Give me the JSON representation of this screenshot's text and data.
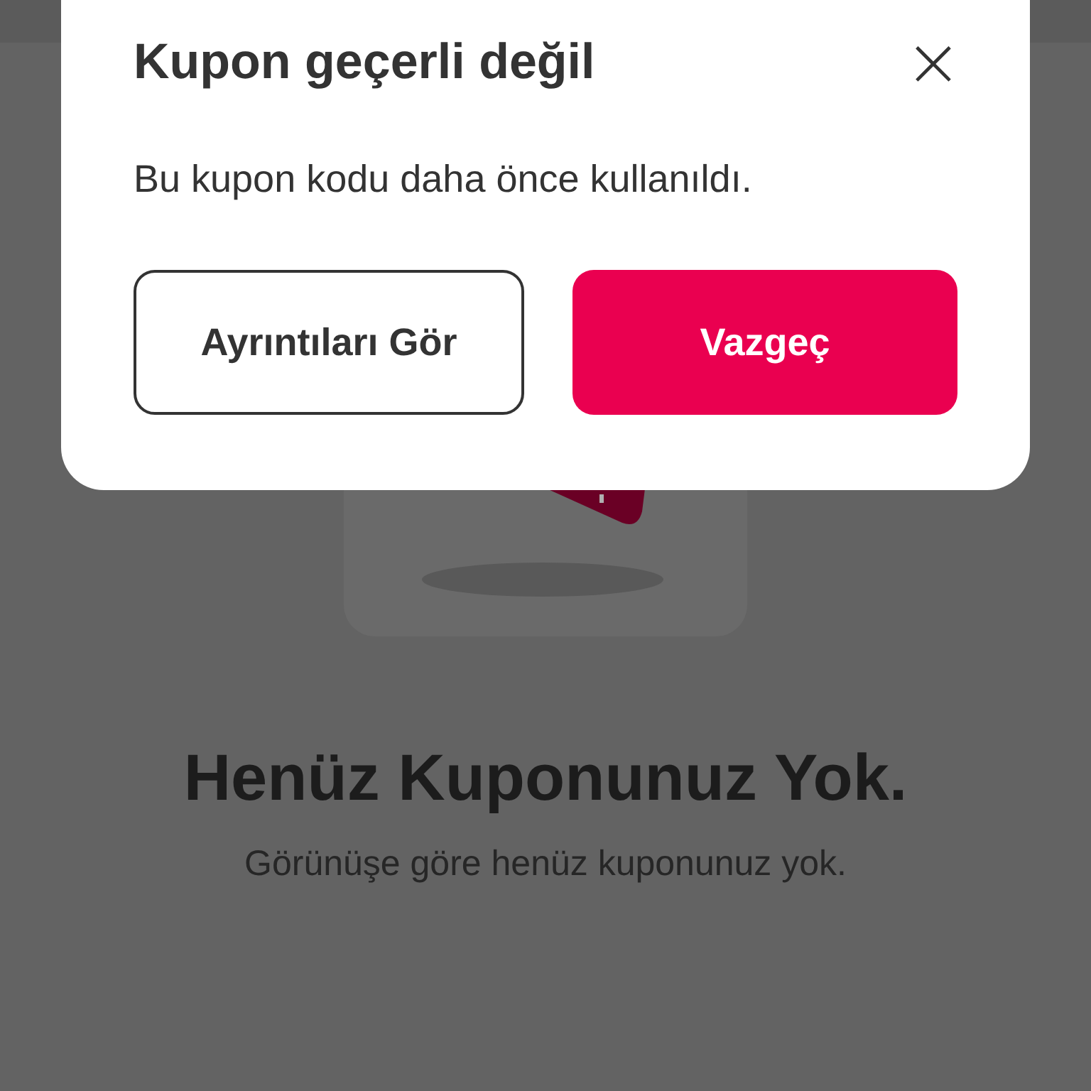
{
  "empty_state": {
    "title": "Henüz Kuponunuz Yok.",
    "message": "Görünüşe göre henüz kuponunuz yok."
  },
  "dialog": {
    "title": "Kupon geçerli değil",
    "close_icon": "×",
    "message": "Bu kupon kodu daha önce kullanıldı.",
    "buttons": [
      {
        "label": "Ayrıntıları Gör",
        "kind": "outline"
      },
      {
        "label": "Vazgeç",
        "kind": "primary"
      }
    ]
  }
}
